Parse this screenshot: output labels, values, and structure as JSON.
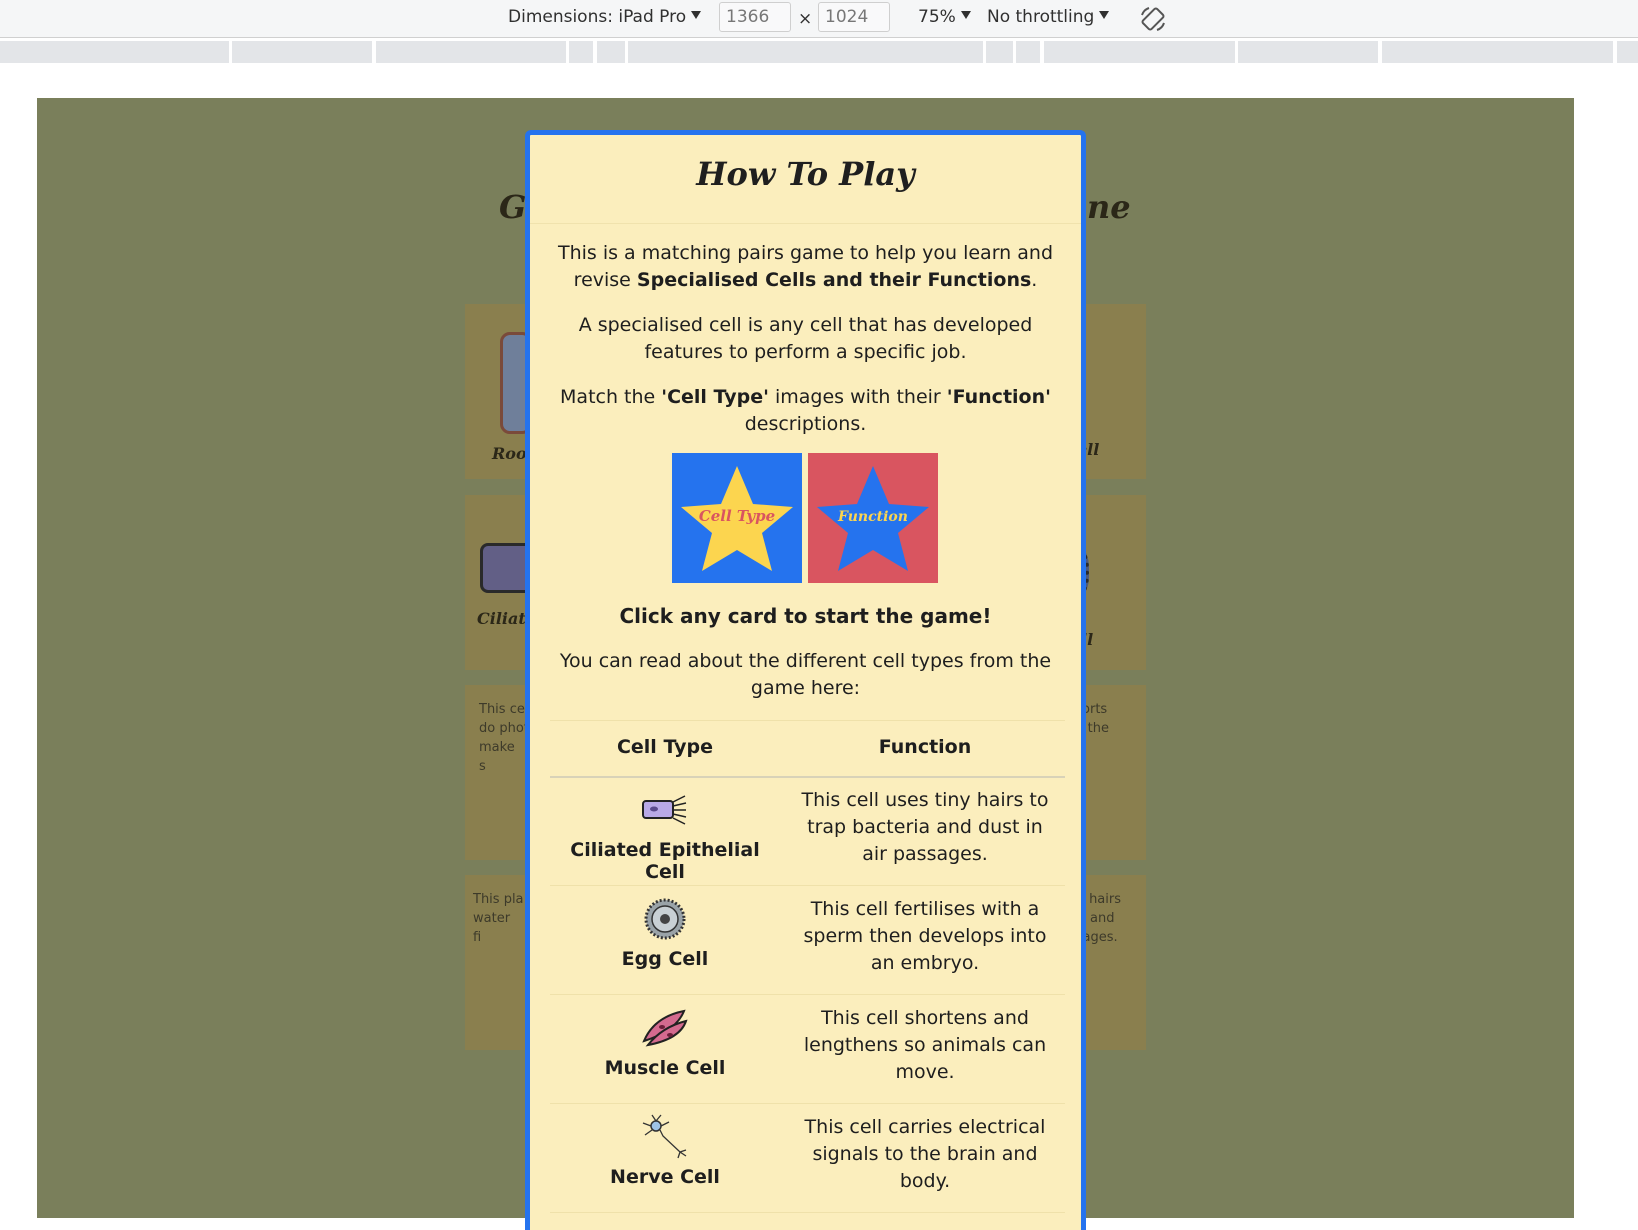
{
  "devtools": {
    "dimensions_label": "Dimensions: iPad Pro",
    "width_value": "1366",
    "times": "×",
    "height_value": "1024",
    "zoom": "75%",
    "throttling": "No throttling"
  },
  "background": {
    "title_left": "G",
    "title_right": "ne",
    "labels": [
      "Root",
      "ell",
      "Ciliate",
      "ll"
    ],
    "texts": [
      "This ce\ndo phot\nmake\ns",
      "sports\nnd the",
      "This pla\nwater\nfi",
      "ny hairs\nria and\nssages."
    ]
  },
  "modal": {
    "title": "How To Play",
    "intro": {
      "text1": "This is a matching pairs game to help you learn and revise ",
      "bold1": "Specialised Cells and their Functions",
      "text2": "."
    },
    "definition": "A specialised cell is any cell that has developed features to perform a specific job.",
    "match": {
      "t1": "Match the ",
      "b1": "'Cell Type'",
      "t2": " images with their ",
      "b2": "'Function'",
      "t3": " descriptions."
    },
    "cards": {
      "cell_type_label": "Cell Type",
      "function_label": "Function",
      "colors": {
        "blue": "#2573ee",
        "red": "#d95560",
        "yellow": "#fcd54f"
      }
    },
    "cta": "Click any card to start the game!",
    "read_more": "You can read about the different cell types from the game here:",
    "table": {
      "headers": [
        "Cell Type",
        "Function"
      ],
      "rows": [
        {
          "name": "Ciliated Epithelial Cell",
          "function": "This cell uses tiny hairs to trap bacteria and dust in air passages.",
          "icon": "ciliated-cell-icon"
        },
        {
          "name": "Egg Cell",
          "function": "This cell fertilises with a sperm then develops into an embryo.",
          "icon": "egg-cell-icon"
        },
        {
          "name": "Muscle Cell",
          "function": "This cell shortens and lengthens so animals can move.",
          "icon": "muscle-cell-icon"
        },
        {
          "name": "Nerve Cell",
          "function": "This cell carries electrical signals to the brain and body.",
          "icon": "nerve-cell-icon"
        }
      ]
    }
  }
}
